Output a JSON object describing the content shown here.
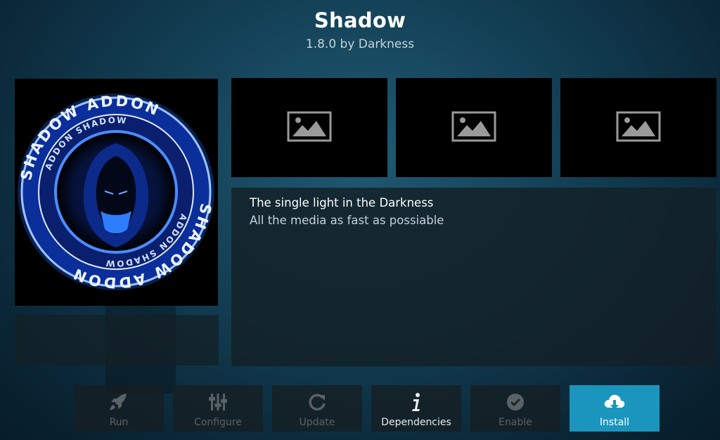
{
  "header": {
    "title": "Shadow",
    "subtitle": "1.8.0 by Darkness"
  },
  "logo": {
    "ring_text_outer": "SHADOW ADDON",
    "ring_text_inner": "ADDON SHADOW"
  },
  "description": {
    "title": "The single light in the Darkness",
    "body": "All the media as fast as possiable"
  },
  "screenshots": [
    {
      "icon": "image-placeholder-icon"
    },
    {
      "icon": "image-placeholder-icon"
    },
    {
      "icon": "image-placeholder-icon"
    }
  ],
  "buttons": [
    {
      "label": "Run",
      "icon": "rocket-icon",
      "state": "disabled"
    },
    {
      "label": "Configure",
      "icon": "sliders-icon",
      "state": "disabled"
    },
    {
      "label": "Update",
      "icon": "refresh-icon",
      "state": "disabled"
    },
    {
      "label": "Dependencies",
      "icon": "info-icon",
      "state": "enabled"
    },
    {
      "label": "Enable",
      "icon": "checkmark-icon",
      "state": "disabled"
    },
    {
      "label": "Install",
      "icon": "cloud-download-icon",
      "state": "focused"
    }
  ],
  "colors": {
    "accent": "#1a95bd",
    "logo_blue": "#2a6fe0"
  }
}
